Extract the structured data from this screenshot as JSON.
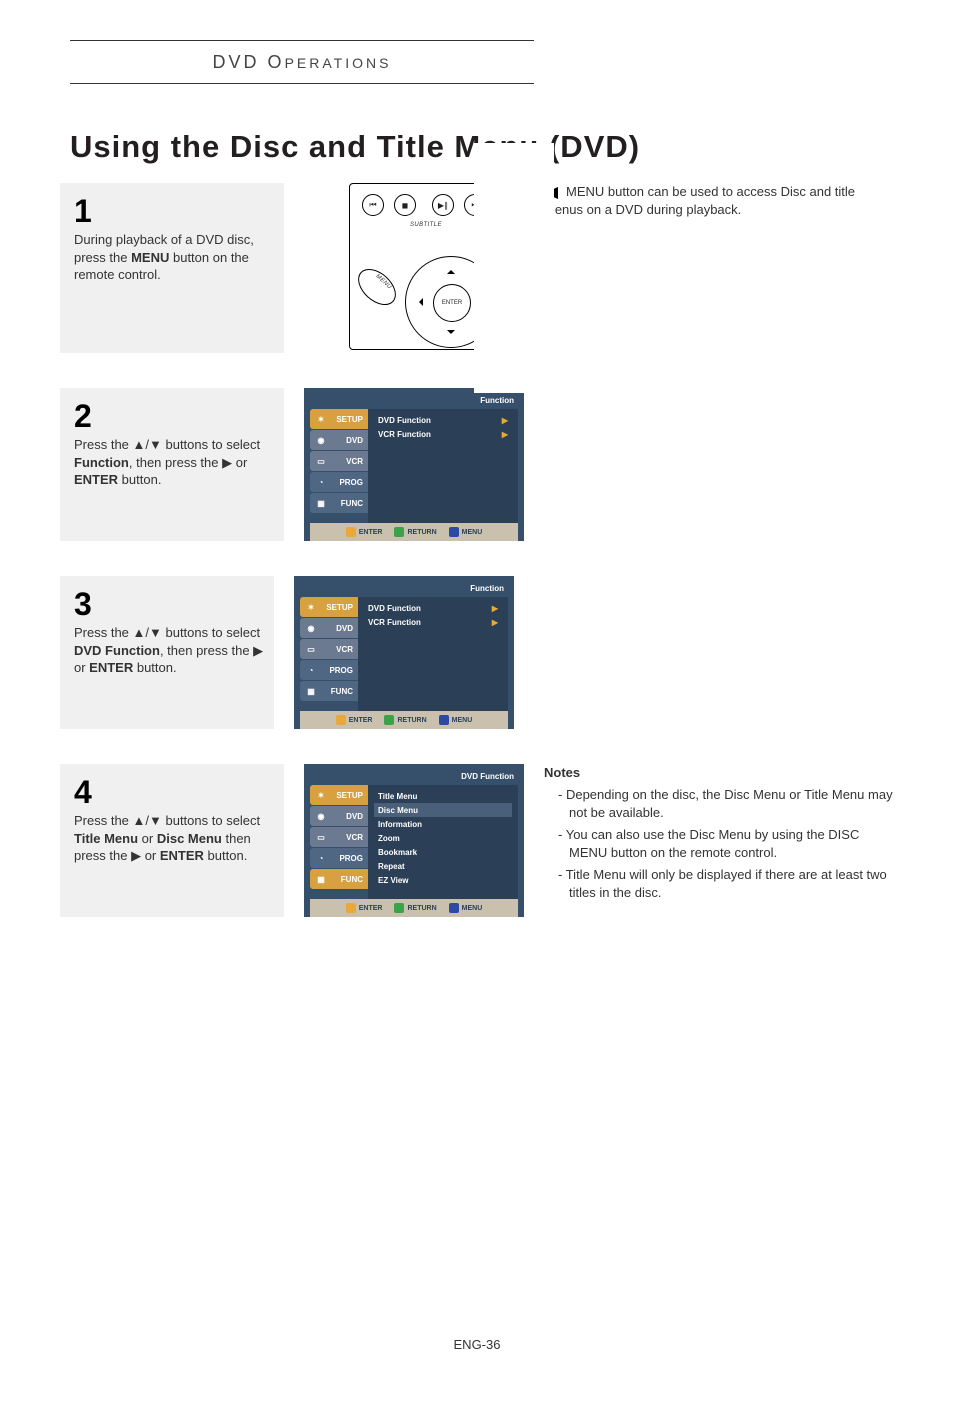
{
  "header_bar": {
    "main": "DVD O",
    "rest": "PERATIONS"
  },
  "page_title": "Using the Disc and Title Menu (DVD)",
  "tip_text": "MENU button can be used to access Disc and title menus on a DVD during playback.",
  "steps": {
    "s1": {
      "num": "1",
      "body_pre": "During playback of a DVD disc, press the ",
      "body_bold": "MENU",
      "body_post": " button on the remote control."
    },
    "s2": {
      "num": "2",
      "body_pre": "Press the ▲/▼ buttons to select ",
      "body_bold": "Function",
      "body_post": ", then press the ▶ or ",
      "body_bold2": "ENTER",
      "body_post2": " button."
    },
    "s3": {
      "num": "3",
      "body_pre": "Press the ▲/▼ buttons to select ",
      "body_bold": "DVD Function",
      "body_post": ", then press the ▶ or ",
      "body_bold2": "ENTER",
      "body_post2": " button."
    },
    "s4": {
      "num": "4",
      "body_pre": "Press the ▲/▼ buttons to select ",
      "body_bold": "Title Menu",
      "body_mid": " or ",
      "body_bold2": "Disc Menu",
      "body_post": " then press the ▶ or ",
      "body_bold3": "ENTER",
      "body_post2": " button."
    }
  },
  "osd_common": {
    "tabs": {
      "setup": "SETUP",
      "dvd": "DVD",
      "vcr": "VCR",
      "prog": "PROG",
      "func": "FUNC"
    },
    "foot": {
      "enter": "ENTER",
      "return": "RETURN",
      "menu": "MENU"
    }
  },
  "osd2": {
    "header": "Function",
    "items": [
      {
        "label": "DVD Function",
        "arrow": "▶"
      },
      {
        "label": "VCR Function",
        "arrow": "▶"
      }
    ]
  },
  "osd3": {
    "header": "Function",
    "items": [
      {
        "label": "DVD Function",
        "arrow": "▶"
      },
      {
        "label": "VCR Function",
        "arrow": "▶"
      }
    ]
  },
  "osd4": {
    "header": "DVD Function",
    "items": [
      {
        "label": "Title Menu"
      },
      {
        "label": "Disc Menu",
        "sel": true
      },
      {
        "label": "Information"
      },
      {
        "label": "Zoom"
      },
      {
        "label": "Bookmark"
      },
      {
        "label": "Repeat"
      },
      {
        "label": "EZ View"
      }
    ]
  },
  "remote": {
    "subtitle": "SUBTITLE",
    "menu": "MENU",
    "enter": "ENTER"
  },
  "notes": {
    "heading": "Notes",
    "items": [
      "Depending on the disc, the Disc Menu or Title Menu may not be available.",
      "You can also use the Disc Menu by using the DISC MENU button on the remote control.",
      "Title Menu will only be displayed if there are at least two titles in the disc."
    ]
  },
  "footer": "ENG-36"
}
